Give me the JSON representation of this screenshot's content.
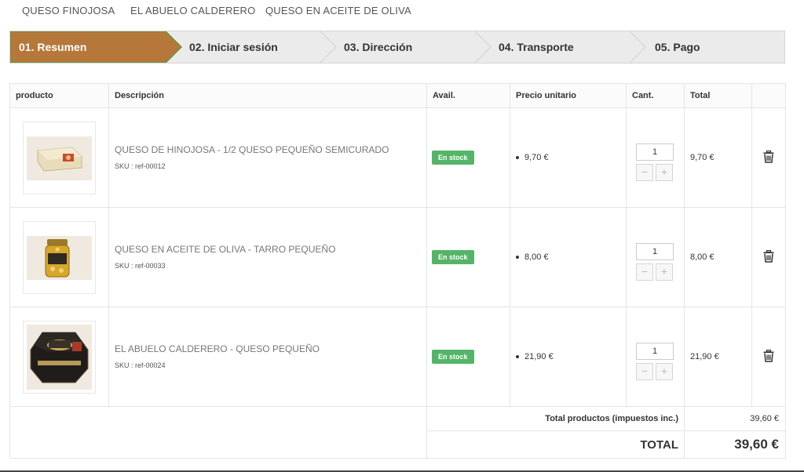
{
  "topnav": {
    "items": [
      "QUESO FINOJOSA",
      "EL ABUELO CALDERERO",
      "QUESO EN ACEITE DE OLIVA"
    ]
  },
  "steps": [
    {
      "label": "01. Resumen",
      "active": true
    },
    {
      "label": "02. Iniciar sesión",
      "active": false
    },
    {
      "label": "03. Dirección",
      "active": false
    },
    {
      "label": "04. Transporte",
      "active": false
    },
    {
      "label": "05. Pago",
      "active": false
    }
  ],
  "colors": {
    "active_step": "#b5773a",
    "active_step_border": "#5f9a3c",
    "stock_badge": "#55b468"
  },
  "table": {
    "headers": {
      "product": "producto",
      "description": "Descripción",
      "avail": "Avail.",
      "unit_price": "Precio unitario",
      "qty": "Cant.",
      "total": "Total"
    },
    "rows": [
      {
        "name": "QUESO DE HINOJOSA - 1/2 QUESO PEQUEÑO SEMICURADO",
        "sku": "SKU : ref-00012",
        "avail": "En stock",
        "unit_price": "9,70 €",
        "qty": "1",
        "total": "9,70 €",
        "image_icon": "half-cheese-image"
      },
      {
        "name": "QUESO EN ACEITE DE OLIVA - TARRO PEQUEÑO",
        "sku": "SKU : ref-00033",
        "avail": "En stock",
        "unit_price": "8,00 €",
        "qty": "1",
        "total": "8,00 €",
        "image_icon": "cheese-jar-image"
      },
      {
        "name": "EL ABUELO CALDERERO - QUESO PEQUEÑO",
        "sku": "SKU : ref-00024",
        "avail": "En stock",
        "unit_price": "21,90 €",
        "qty": "1",
        "total": "21,90 €",
        "image_icon": "cheese-box-image"
      }
    ],
    "summary": {
      "products_label": "Total productos (impuestos inc.)",
      "products_value": "39,60 €",
      "grand_label": "TOTAL",
      "grand_value": "39,60 €"
    },
    "qty_minus": "−",
    "qty_plus": "+"
  }
}
